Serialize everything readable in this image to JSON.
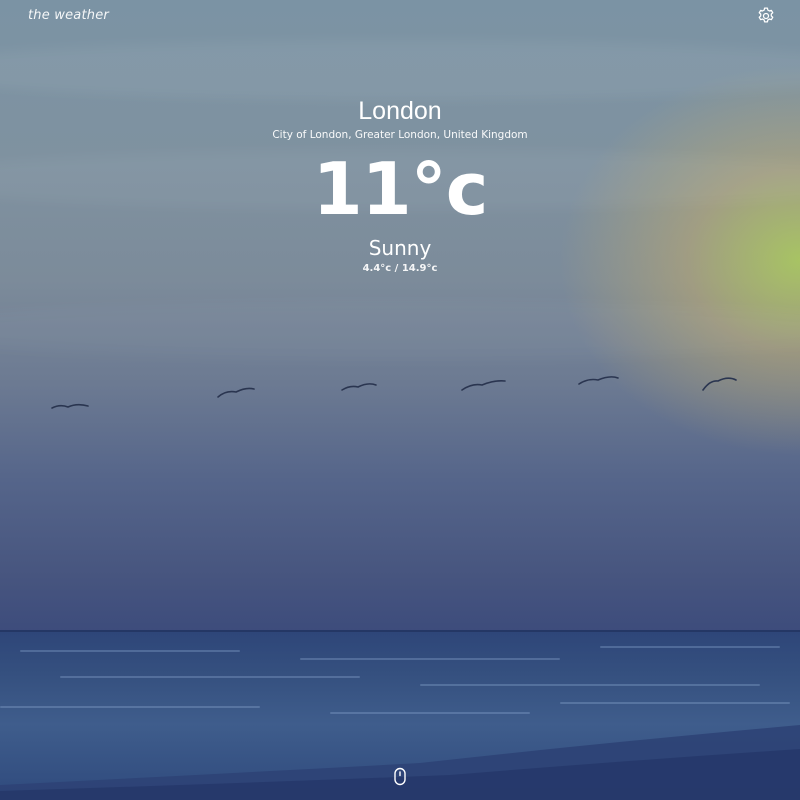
{
  "app": {
    "title": "the weather"
  },
  "location": {
    "city": "London",
    "region": "City of London, Greater London, United Kingdom"
  },
  "weather": {
    "temperature": "11°c",
    "condition": "Sunny",
    "range": "4.4°c / 14.9°c"
  },
  "icons": {
    "settings": "gear-icon",
    "scroll": "mouse-icon"
  },
  "colors": {
    "text": "#ffffff"
  }
}
